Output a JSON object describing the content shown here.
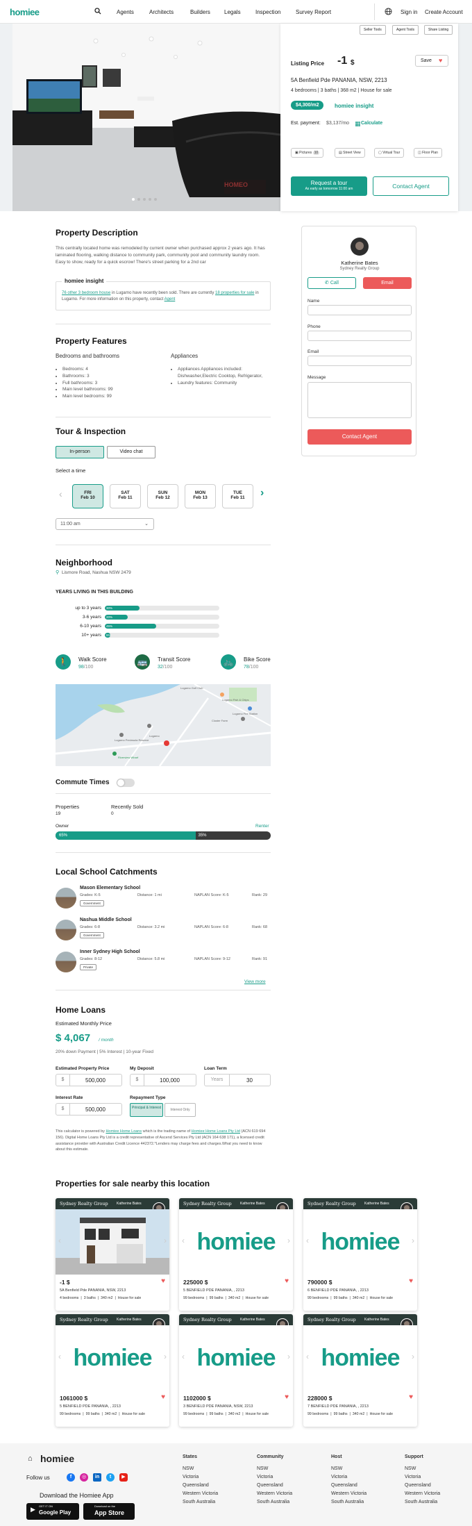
{
  "header": {
    "logo": "homiee",
    "nav": [
      "Agents",
      "Architects",
      "Builders",
      "Legals",
      "Inspection",
      "Survey Report"
    ],
    "sign_in": "Sign in",
    "create_account": "Create Account"
  },
  "hero": {
    "tools": [
      "Seller Tools",
      "Agent Tools",
      "Share Listing"
    ],
    "listing_price_label": "Listing Price",
    "price": "-1",
    "currency": "$",
    "save": "Save",
    "address": "5A Benfield Pde PANANIA, NSW, 2213",
    "summary": "4 bedrooms | 3 baths | 368 m2 | House for sale",
    "price_per_m2": "$4,300/m2",
    "insight": "homiee insight",
    "est_label": "Est. payment:",
    "est_value": "$3,137/mo",
    "calculate": "Calculate",
    "media": [
      "Pictures",
      "Street View",
      "Virtual Tour",
      "Floor Plan"
    ],
    "pictures_count": "10",
    "request_tour": "Request a tour",
    "request_sub": "As early as tomorrow 11:00 am",
    "contact_agent": "Contact Agent",
    "watermark": "HOMEO"
  },
  "description": {
    "title": "Property Description",
    "text": "This centrally located home was remodeled by current owner when purchased approx 2 years ago. It has laminated flooring, walking distance to community park, community pool and community laundry room. Easy to show, ready for a quick escrow! There's street parking for a 2nd car",
    "insight_title": "homiee insight",
    "insight_pre": "76 other 3 bedroom house",
    "insight_mid1": " in Lugarno have recently been sold. There are currently ",
    "insight_link2": "18 properties for sale",
    "insight_mid2": " in Lugarno. For more information on this property, contact ",
    "insight_link3": "Agent"
  },
  "agent": {
    "name": "Katherine Bates",
    "company": "Sydney Realty Group",
    "call": "Call",
    "email": "Email",
    "fields": [
      "Name",
      "Phone",
      "Email",
      "Message"
    ],
    "submit": "Contact Agent"
  },
  "features": {
    "title": "Property Features",
    "col1_title": "Bedrooms and bathrooms",
    "col1": [
      "Bedrooms: 4",
      "Bathrooms: 3",
      "Full bathrooms: 3",
      "Main level bathrooms: 99",
      "Main level bedrooms: 99"
    ],
    "col2_title": "Appliances",
    "col2": [
      "Appliances Appliances included: Dishwasher,Electric Cooktop, Refrigerator,",
      "Laundry features: Community"
    ]
  },
  "tour": {
    "title": "Tour & Inspection",
    "modes": [
      "In-person",
      "Video chat"
    ],
    "select_time": "Select a time",
    "days": [
      {
        "d": "FRI",
        "date": "Feb 10"
      },
      {
        "d": "SAT",
        "date": "Feb 11"
      },
      {
        "d": "SUN",
        "date": "Feb 12"
      },
      {
        "d": "MON",
        "date": "Feb 13"
      },
      {
        "d": "TUE",
        "date": "Feb 11"
      }
    ],
    "time": "11:00 am"
  },
  "neighborhood": {
    "title": "Neighborhood",
    "address": "Lismore Road, Nashua NSW 2479",
    "years_title": "YEARS LIVING IN THIS BUILDING",
    "years": [
      {
        "label": "up to 3 years",
        "pct": 30
      },
      {
        "label": "3-6 years",
        "pct": 20
      },
      {
        "label": "6-10 years",
        "pct": 45
      },
      {
        "label": "10+ years",
        "pct": 5
      }
    ],
    "scores": [
      {
        "name": "Walk Score",
        "value": "98",
        "max": "/100"
      },
      {
        "name": "Transit Score",
        "value": "32",
        "max": "/100"
      },
      {
        "name": "Bike Score",
        "value": "78",
        "max": "/100"
      }
    ],
    "map_labels": [
      "Lugarno",
      "Lugarno Golf Club",
      "Lugarno Fish & Chips",
      "Lugarno Fire Station",
      "Woolworths",
      "Cluster Farm",
      "Lugarno Peninsula Reserve",
      "Bureau",
      "Vilbiano Shopping Centre",
      "Riverview Wharf",
      "Bank",
      "Clubhouse",
      "Forest Rd",
      "Lugarno Ave"
    ]
  },
  "commute": {
    "title": "Commute Times",
    "properties_label": "Properties",
    "properties_value": "19",
    "sold_label": "Recently Sold",
    "sold_value": "0",
    "owner": "Owner",
    "renter": "Renter",
    "owner_pct": "65%",
    "renter_pct": "35%",
    "owner_frac": 0.65
  },
  "schools": {
    "title": "Local School Catchments",
    "list": [
      {
        "name": "Mason Elementary School",
        "grades": "Grades: K-5",
        "distance": "Distance: 1 mi",
        "naplan": "NAPLAN Score: K-5",
        "rank": "Rank: 29",
        "type": "Government"
      },
      {
        "name": "Nashua Middle School",
        "grades": "Grades: 6-8",
        "distance": "Distance: 3.2 mi",
        "naplan": "NAPLAN Score: 6-8",
        "rank": "Rank: 68",
        "type": "Government"
      },
      {
        "name": "Inner Sydney High School",
        "grades": "Grades: 8-12",
        "distance": "Distance: 5.8 mi",
        "naplan": "NAPLAN Score: 9-12",
        "rank": "Rank: 91",
        "type": "Private"
      }
    ],
    "view_more": "View more"
  },
  "loans": {
    "title": "Home Loans",
    "est_label": "Estimated Monthly Price",
    "amount": "$ 4,067",
    "per": "/ month",
    "terms": "20% down Payment | 5% Interest | 10-year Fixed",
    "fields": [
      {
        "label": "Estimated Property Price",
        "prefix": "$",
        "value": "500,000"
      },
      {
        "label": "My Deposit",
        "prefix": "$",
        "value": "100,000"
      },
      {
        "label": "Loan Term",
        "prefix": "Years",
        "value": "30"
      },
      {
        "label": "Interest Rate",
        "prefix": "$",
        "value": "500,000"
      }
    ],
    "repay_label": "Repayment Type",
    "repay": [
      "Principal & Interest",
      "Interest Only"
    ],
    "disclaimer_1": "This calculator is powered by ",
    "disclaimer_link1": "Homiee Home Loans",
    "disclaimer_2": " which is the trading name of ",
    "disclaimer_link2": "Homiee Home Loans Pty Ltd",
    "disclaimer_3": " (ACN 619 694 156). Digital Home Loans Pty Ltd is a credit representative of Ascend Services Pty Ltd (ACN 164 638 171), a licensed credit assistance provider with Australian Credit Licence 442372.*Lenders may charge fees and charges.What you need to know about this estimate."
  },
  "nearby": {
    "title": "Properties for sale nearby this location",
    "agency": "Sydney Realty Group",
    "agent": "Katherine Bates",
    "logo": "homiee",
    "cards": [
      {
        "price": "-1 $",
        "addr": "5A Benfield Pde PANANIA, NSW, 2213",
        "facts": [
          "4 bedrooms",
          "3 baths",
          "340 m2",
          "House for sale"
        ]
      },
      {
        "price": "225000 $",
        "addr": "5 BENFIELD PDE PANANIA, , 2213",
        "facts": [
          "99 bedrooms",
          "99 baths",
          "340 m2",
          "House for sale"
        ]
      },
      {
        "price": "790000 $",
        "addr": "6 BENFIELD PDE PANANIA, , 2213",
        "facts": [
          "99 bedrooms",
          "99 baths",
          "340 m2",
          "House for sale"
        ]
      },
      {
        "price": "1061000 $",
        "addr": "5 BENFIELD PDE PANANIA, , 2213",
        "facts": [
          "99 bedrooms",
          "99 baths",
          "340 m2",
          "House for sale"
        ]
      },
      {
        "price": "1102000 $",
        "addr": "3 BENFIELD PDE PANANIA, NSW, 2213",
        "facts": [
          "99 bedrooms",
          "99 baths",
          "340 m2",
          "House for sale"
        ]
      },
      {
        "price": "228000 $",
        "addr": "7 BENFIELD PDE PANANIA, , 2213",
        "facts": [
          "99 bedrooms",
          "99 baths",
          "340 m2",
          "House for sale"
        ]
      }
    ]
  },
  "footer": {
    "logo": "homiee",
    "follow": "Follow us",
    "download": "Download the Homiee App",
    "google": "Google Play",
    "apple": "App Store",
    "google_small": "GET IT ON",
    "apple_small": "Download on the",
    "cols": [
      {
        "h": "States",
        "items": [
          "NSW",
          "Victoria",
          "Queensland",
          "Western Victoria",
          "South Australia"
        ]
      },
      {
        "h": "Community",
        "items": [
          "NSW",
          "Victoria",
          "Queensland",
          "Western Victoria",
          "South Australia"
        ]
      },
      {
        "h": "Host",
        "items": [
          "NSW",
          "Victoria",
          "Queensland",
          "Western Victoria",
          "South Australia"
        ]
      },
      {
        "h": "Support",
        "items": [
          "NSW",
          "Victoria",
          "Queensland",
          "Western Victoria",
          "South Australia"
        ]
      }
    ]
  },
  "colors": {
    "accent": "#179c88",
    "red": "#ec5a5a"
  }
}
